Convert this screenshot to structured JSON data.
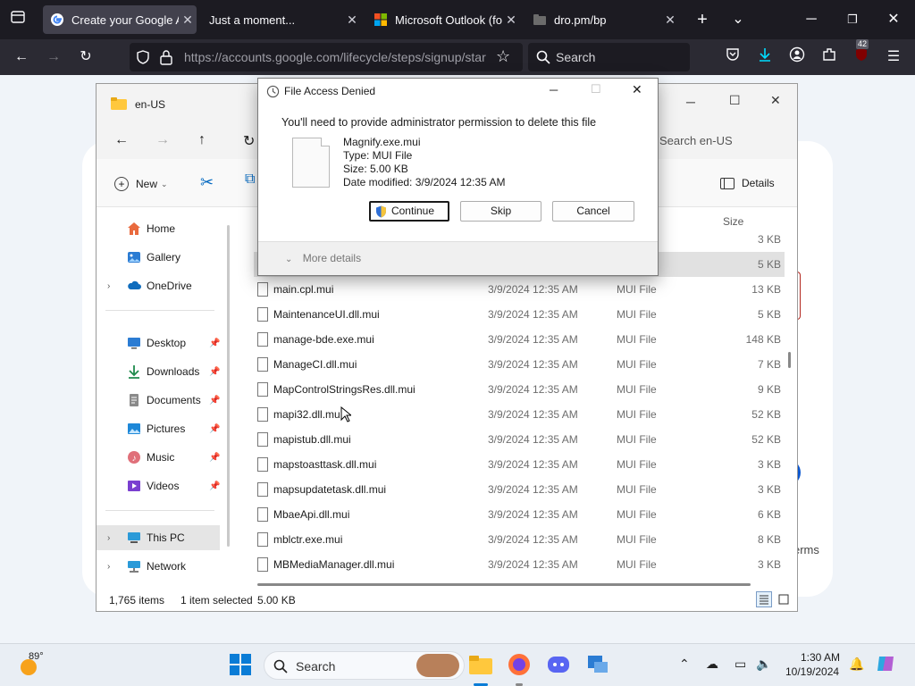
{
  "browser": {
    "tabs": [
      {
        "title": "Create your Google Acc",
        "active": true
      },
      {
        "title": "Just a moment...",
        "active": false
      },
      {
        "title": "Microsoft Outlook (forr",
        "active": false
      },
      {
        "title": "dro.pm/bp",
        "active": false
      }
    ],
    "url": "https://accounts.google.com/lifecycle/steps/signup/star",
    "search_placeholder": "Search",
    "extension_badge": "42"
  },
  "webpage": {
    "terms_fragment": "erms"
  },
  "explorer": {
    "title": "en-US",
    "search_placeholder": "Search en-US",
    "new_label": "New",
    "details_label": "Details",
    "sidebar": {
      "home": "Home",
      "gallery": "Gallery",
      "onedrive": "OneDrive",
      "desktop": "Desktop",
      "downloads": "Downloads",
      "documents": "Documents",
      "pictures": "Pictures",
      "music": "Music",
      "videos": "Videos",
      "thispc": "This PC",
      "network": "Network"
    },
    "columns": {
      "size": "Size"
    },
    "rows": [
      {
        "name": "",
        "date": "",
        "type": "",
        "size": "3 KB"
      },
      {
        "name": "",
        "date": "",
        "type": "",
        "size": "5 KB"
      },
      {
        "name": "main.cpl.mui",
        "date": "3/9/2024 12:35 AM",
        "type": "MUI File",
        "size": "13 KB"
      },
      {
        "name": "MaintenanceUI.dll.mui",
        "date": "3/9/2024 12:35 AM",
        "type": "MUI File",
        "size": "5 KB"
      },
      {
        "name": "manage-bde.exe.mui",
        "date": "3/9/2024 12:35 AM",
        "type": "MUI File",
        "size": "148 KB"
      },
      {
        "name": "ManageCI.dll.mui",
        "date": "3/9/2024 12:35 AM",
        "type": "MUI File",
        "size": "7 KB"
      },
      {
        "name": "MapControlStringsRes.dll.mui",
        "date": "3/9/2024 12:35 AM",
        "type": "MUI File",
        "size": "9 KB"
      },
      {
        "name": "mapi32.dll.mui",
        "date": "3/9/2024 12:35 AM",
        "type": "MUI File",
        "size": "52 KB"
      },
      {
        "name": "mapistub.dll.mui",
        "date": "3/9/2024 12:35 AM",
        "type": "MUI File",
        "size": "52 KB"
      },
      {
        "name": "mapstoasttask.dll.mui",
        "date": "3/9/2024 12:35 AM",
        "type": "MUI File",
        "size": "3 KB"
      },
      {
        "name": "mapsupdatetask.dll.mui",
        "date": "3/9/2024 12:35 AM",
        "type": "MUI File",
        "size": "3 KB"
      },
      {
        "name": "MbaeApi.dll.mui",
        "date": "3/9/2024 12:35 AM",
        "type": "MUI File",
        "size": "6 KB"
      },
      {
        "name": "mblctr.exe.mui",
        "date": "3/9/2024 12:35 AM",
        "type": "MUI File",
        "size": "8 KB"
      },
      {
        "name": "MBMediaManager.dll.mui",
        "date": "3/9/2024 12:35 AM",
        "type": "MUI File",
        "size": "3 KB"
      }
    ],
    "status": {
      "item_count": "1,765 items",
      "selected": "1 item selected",
      "selected_size": "5.00 KB"
    }
  },
  "dialog": {
    "title": "File Access Denied",
    "message": "You'll need to provide administrator permission to delete this file",
    "file_name": "Magnify.exe.mui",
    "file_type": "Type: MUI File",
    "file_size": "Size: 5.00 KB",
    "file_date": "Date modified: 3/9/2024 12:35 AM",
    "continue_label": "Continue",
    "skip_label": "Skip",
    "cancel_label": "Cancel",
    "more_details_label": "More details"
  },
  "taskbar": {
    "weather_temp": "89°",
    "search_placeholder": "Search",
    "time": "1:30 AM",
    "date": "10/19/2024"
  }
}
